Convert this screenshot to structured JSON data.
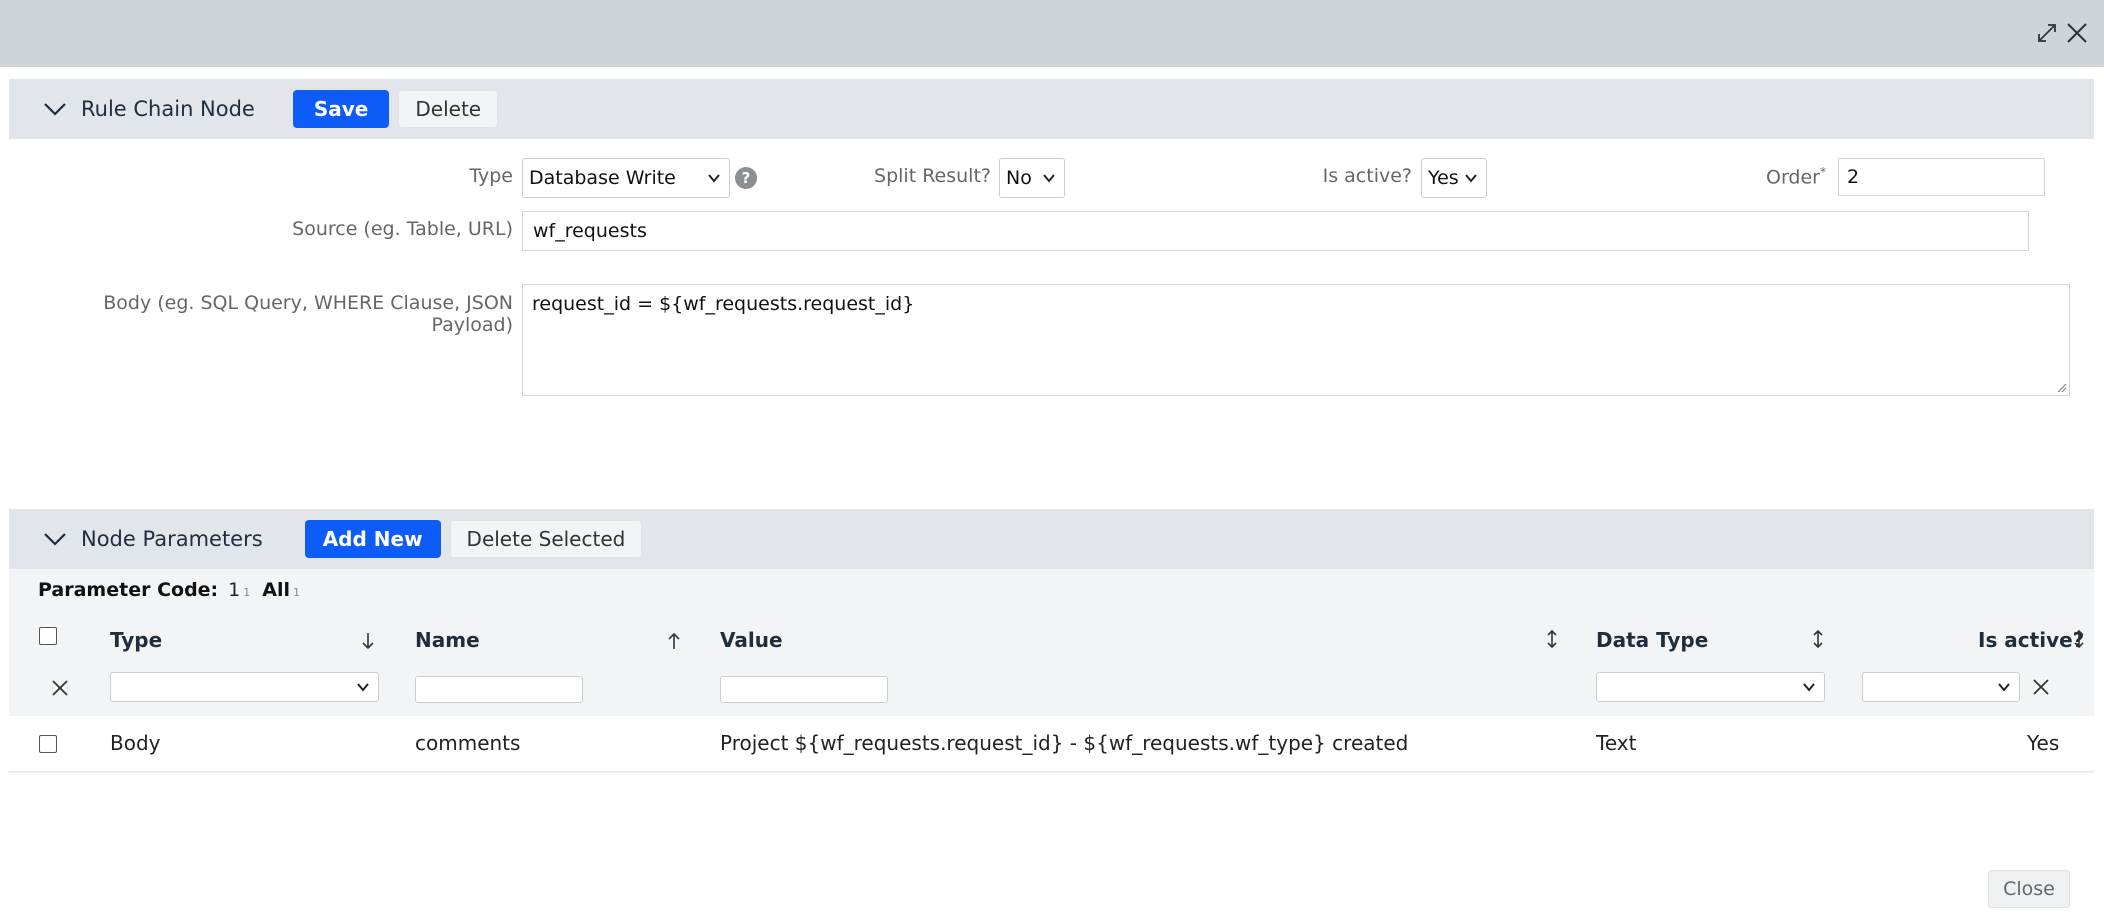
{
  "rule_chain_node": {
    "title": "Rule Chain Node",
    "save_label": "Save",
    "delete_label": "Delete",
    "type_label": "Type",
    "type_value": "Database Write",
    "help_glyph": "?",
    "split_result_label": "Split Result?",
    "split_result_value": "No",
    "is_active_label": "Is active?",
    "is_active_value": "Yes",
    "order_label": "Order",
    "order_required_mark": "*",
    "order_value": "2",
    "source_label": "Source (eg. Table, URL)",
    "source_value": "wf_requests",
    "body_label": "Body (eg. SQL Query, WHERE Clause, JSON Payload)",
    "body_value": "request_id = ${wf_requests.request_id}"
  },
  "node_parameters": {
    "title": "Node Parameters",
    "add_new_label": "Add New",
    "delete_selected_label": "Delete Selected",
    "parameter_code_label": "Parameter Code:",
    "parameter_code_value": "1",
    "parameter_code_count": "1",
    "all_label": "All",
    "all_count": "1",
    "columns": {
      "type": "Type",
      "name": "Name",
      "value": "Value",
      "data_type": "Data Type",
      "is_active": "Is active?"
    },
    "rows": [
      {
        "type": "Body",
        "name": "comments",
        "value": "Project ${wf_requests.request_id} - ${wf_requests.wf_type} created",
        "data_type": "Text",
        "is_active": "Yes"
      }
    ]
  },
  "footer": {
    "close_label": "Close"
  },
  "colors": {
    "primary": "#0d5cf7",
    "header_bg": "#e2e6ea",
    "topbar_bg": "#cfd4d9"
  },
  "icons": [
    "expand-icon",
    "close-icon",
    "chevron-down-icon",
    "help-icon",
    "sort-down-icon",
    "sort-up-icon",
    "sort-both-icon",
    "caret-down-icon",
    "clear-filter-icon"
  ]
}
